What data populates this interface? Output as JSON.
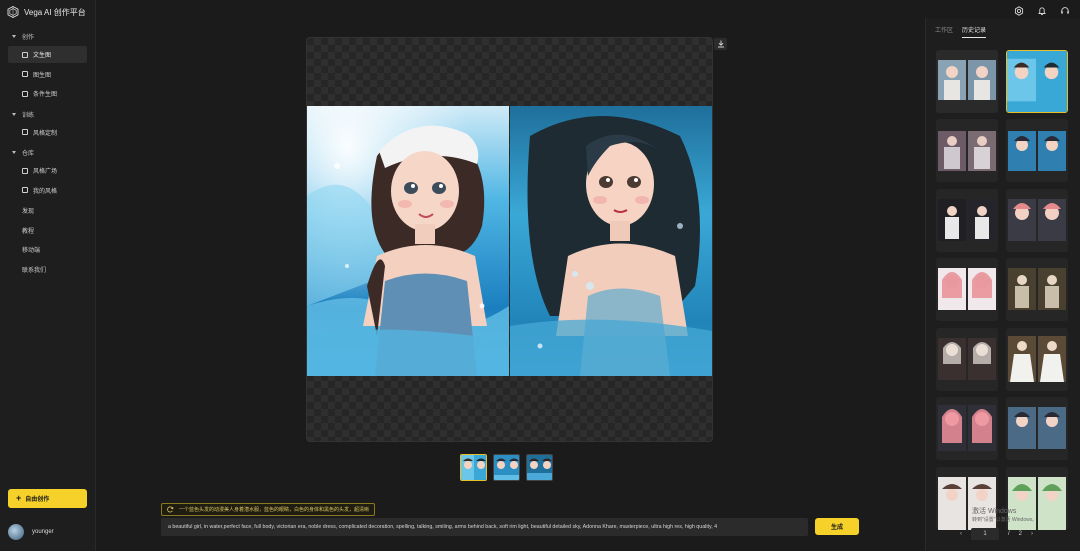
{
  "app": {
    "title": "Vega AI 创作平台"
  },
  "sidebar": {
    "groups": [
      {
        "label": "创作",
        "items": [
          {
            "label": "文生图"
          },
          {
            "label": "图生图"
          },
          {
            "label": "条件生图"
          }
        ]
      },
      {
        "label": "训练",
        "items": [
          {
            "label": "风格定制"
          }
        ]
      },
      {
        "label": "仓库",
        "items": [
          {
            "label": "风格广场"
          },
          {
            "label": "我的风格"
          }
        ]
      }
    ],
    "links": [
      {
        "label": "发现"
      },
      {
        "label": "教程"
      },
      {
        "label": "移动端"
      },
      {
        "label": "联系我们"
      }
    ],
    "create_button": "自由创作",
    "user": {
      "name": "younger"
    }
  },
  "right_panel": {
    "tabs": [
      {
        "label": "工作区"
      },
      {
        "label": "历史记录"
      }
    ],
    "pager": {
      "current": "1",
      "separator": "/",
      "total": "2"
    }
  },
  "hint": {
    "text": "一个蓝色头发的动漫美人身着潜水服，蓝色的眼睛，白色的身体和黑色的头发，超清晰"
  },
  "prompt": {
    "value": "a beautiful girl, in water,perfect face, full body, victorian era, noble dress, complicated decoration, spelling, talking, smiling, arms behind back, soft rim light, beautiful detailed sky, Adonna Khare, masterpiece, ultra high res, high quality, 4"
  },
  "generate_button": "生成",
  "watermark": {
    "line1": "激活 Windows",
    "line2": "转到\"设置\"以激活 Windows。"
  },
  "colors": {
    "accent": "#f5d12a",
    "background": "#1b1b1b",
    "panel": "#1e1e1e"
  }
}
